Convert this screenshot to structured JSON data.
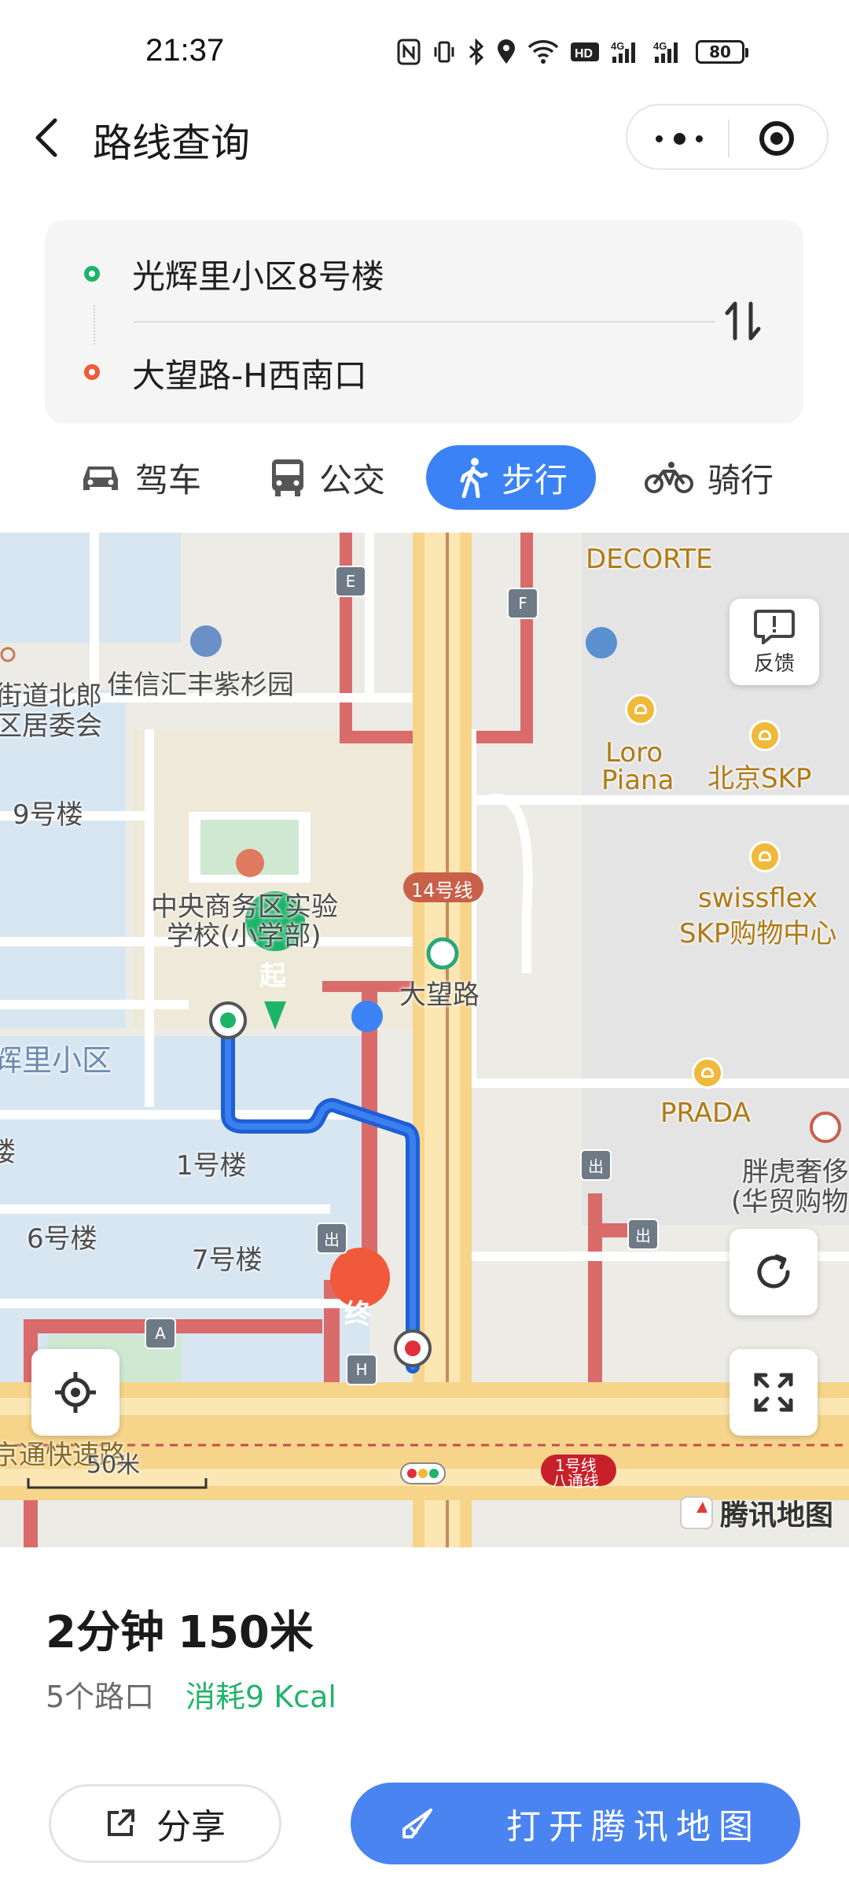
{
  "status": {
    "time": "21:37",
    "battery": "80"
  },
  "header": {
    "title": "路线查询"
  },
  "route": {
    "from": "光辉里小区8号楼",
    "to": "大望路-H西南口"
  },
  "modes": [
    {
      "label": "驾车",
      "icon": "car-icon",
      "active": false
    },
    {
      "label": "公交",
      "icon": "bus-icon",
      "active": false
    },
    {
      "label": "步行",
      "icon": "walk-icon",
      "active": true
    },
    {
      "label": "骑行",
      "icon": "bike-icon",
      "active": false
    }
  ],
  "map": {
    "labels": {
      "decorte": "DECORTE",
      "jiaxin": "佳信汇丰紫杉园",
      "street_office_1": "街道北郎",
      "street_office_2": "区居委会",
      "loro_1": "Loro",
      "loro_2": "Piana",
      "skp": "北京SKP",
      "swissflex_1": "swissflex",
      "swissflex_2": "SKP购物中心",
      "bldg9": "9号楼",
      "school_1": "中央商务区实验",
      "school_2": "学校(小学部)",
      "line14": "14号线",
      "dawanglu": "大望路",
      "community": "辉里小区",
      "bldg1": "1号楼",
      "bldg6": "6号楼",
      "bldg7": "7号楼",
      "lou": "楼",
      "prada": "PRADA",
      "panghu_1": "胖虎奢侈",
      "panghu_2": "(华贸购物",
      "expressway": "京通快速路",
      "line1_1": "1号线",
      "line1_2": "八通线",
      "scale": "50米"
    },
    "exit_tags": {
      "e": "E",
      "f": "F",
      "a": "A",
      "h": "H",
      "chu1": "出",
      "chu2": "出",
      "chu3": "出"
    },
    "start_marker": "起",
    "end_marker": "终",
    "feedback": "反馈",
    "brand": "腾讯地图"
  },
  "summary": {
    "time": "2分钟",
    "distance": "150米",
    "crossings": "5个路口",
    "calories": "消耗9 Kcal"
  },
  "actions": {
    "share": "分享",
    "open": "打开腾讯地图"
  },
  "colors": {
    "accent": "#3b82f6",
    "start": "#1db46a",
    "end": "#f05a3a",
    "route": "#1f5fd6",
    "kcal": "#22b36b"
  }
}
